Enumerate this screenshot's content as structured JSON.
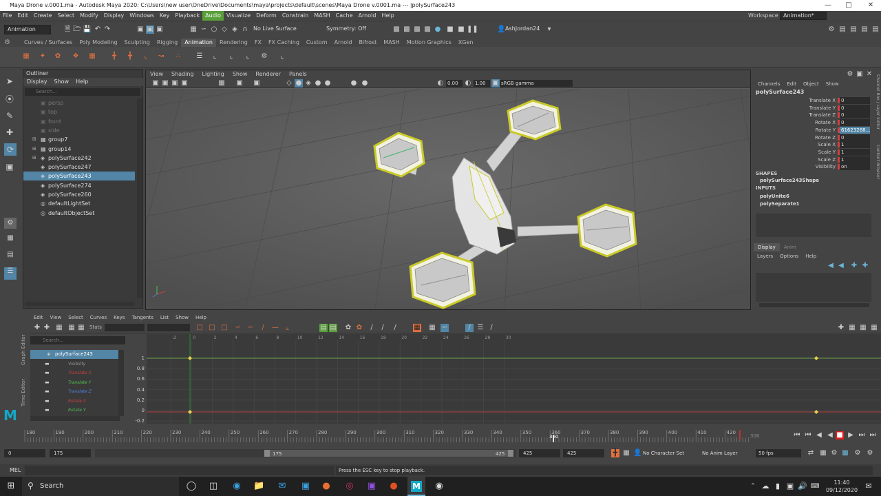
{
  "title": "Maya Drone v.0001.ma - Autodesk Maya 2020: C:\\Users\\new user\\OneDrive\\Documents\\maya\\projects\\default\\scenes\\Maya Drone v.0001.ma   ---   |polySurface243",
  "menu": [
    "File",
    "Edit",
    "Create",
    "Select",
    "Modify",
    "Display",
    "Windows",
    "Key",
    "Playback",
    "Audio",
    "Visualize",
    "Deform",
    "Constrain",
    "MASH",
    "Cache",
    "Arnold",
    "Help"
  ],
  "workspace_label": "Workspace :",
  "workspace_value": "Animation*",
  "mode_menu": "Animation",
  "live_surface": "No Live Surface",
  "symmetry": "Symmetry: Off",
  "user": "AshJordan24",
  "shelf_tabs": [
    "Curves / Surfaces",
    "Poly Modeling",
    "Sculpting",
    "Rigging",
    "Animation",
    "Rendering",
    "FX",
    "FX Caching",
    "Custom",
    "Arnold",
    "Bifrost",
    "MASH",
    "Motion Graphics",
    "XGen"
  ],
  "shelf_active": "Animation",
  "outliner": {
    "title": "Outliner",
    "menu": [
      "Display",
      "Show",
      "Help"
    ],
    "search_placeholder": "Search...",
    "items": [
      {
        "label": "persp",
        "dim": true
      },
      {
        "label": "top",
        "dim": true
      },
      {
        "label": "front",
        "dim": true
      },
      {
        "label": "side",
        "dim": true
      },
      {
        "label": "group7",
        "dim": false
      },
      {
        "label": "group14",
        "dim": false
      },
      {
        "label": "polySurface242",
        "dim": false
      },
      {
        "label": "polySurface247",
        "dim": false
      },
      {
        "label": "polySurface243",
        "dim": false,
        "selected": true
      },
      {
        "label": "polySurface274",
        "dim": false
      },
      {
        "label": "polySurface260",
        "dim": false
      },
      {
        "label": "defaultLightSet",
        "dim": false
      },
      {
        "label": "defaultObjectSet",
        "dim": false
      }
    ]
  },
  "viewport": {
    "menu": [
      "View",
      "Shading",
      "Lighting",
      "Show",
      "Renderer",
      "Panels"
    ],
    "exposure": "0.00",
    "gamma": "1.00",
    "colorspace": "sRGB gamma"
  },
  "channelbox": {
    "menu": [
      "Channels",
      "Edit",
      "Object",
      "Show"
    ],
    "object": "polySurface243",
    "channels": [
      {
        "label": "Translate X",
        "value": "0"
      },
      {
        "label": "Translate Y",
        "value": "0"
      },
      {
        "label": "Translate Z",
        "value": "0"
      },
      {
        "label": "Rotate X",
        "value": "0"
      },
      {
        "label": "Rotate Y",
        "value": "61623268..."
      },
      {
        "label": "Rotate Z",
        "value": "0"
      },
      {
        "label": "Scale X",
        "value": "1"
      },
      {
        "label": "Scale Y",
        "value": "1"
      },
      {
        "label": "Scale Z",
        "value": "1"
      },
      {
        "label": "Visibility",
        "value": "on"
      }
    ],
    "shapes_header": "SHAPES",
    "shape": "polySurface243Shape",
    "inputs_header": "INPUTS",
    "inputs": [
      "polyUnite6",
      "polySeparate1"
    ],
    "layer_tabs": [
      "Display",
      "Anim"
    ],
    "layer_menu": [
      "Layers",
      "Options",
      "Help"
    ],
    "side_tabs": [
      "Channel Box / Layer Editor",
      "Content Browser"
    ]
  },
  "graph_editor": {
    "side_label": "Graph Editor",
    "menu": [
      "Edit",
      "View",
      "Select",
      "Curves",
      "Keys",
      "Tangents",
      "List",
      "Show",
      "Help"
    ],
    "stats": "Stats",
    "search_placeholder": "Search...",
    "tree": [
      {
        "label": "polySurface243",
        "color": "#ffffff",
        "selected": true
      },
      {
        "label": "Visibility",
        "color": "#999999"
      },
      {
        "label": "Translate X",
        "color": "#d04040"
      },
      {
        "label": "Translate Y",
        "color": "#50c050"
      },
      {
        "label": "Translate Z",
        "color": "#5080e0"
      },
      {
        "label": "Rotate X",
        "color": "#d04040"
      },
      {
        "label": "Rotate Y",
        "color": "#50c050"
      }
    ],
    "y_ticks": [
      "1",
      "0.8",
      "0.6",
      "0.4",
      "0.2",
      "0",
      "-0.2"
    ],
    "x_ticks": [
      "-2",
      "0",
      "2",
      "4",
      "6",
      "8",
      "10",
      "12",
      "14",
      "16",
      "18",
      "20",
      "22",
      "24",
      "26",
      "28",
      "30"
    ]
  },
  "time_side_label": "Time Editor",
  "timeslider": {
    "ticks": [
      "180",
      "190",
      "200",
      "210",
      "220",
      "230",
      "240",
      "250",
      "260",
      "270",
      "280",
      "290",
      "300",
      "310",
      "320",
      "330",
      "340",
      "350",
      "360",
      "370",
      "380",
      "390",
      "400",
      "410",
      "420"
    ],
    "current_frame": "360",
    "current_display": "306"
  },
  "range": {
    "start": "0",
    "play_start": "175",
    "slider_start": "175",
    "slider_end": "425",
    "play_end": "425",
    "end": "425",
    "character_set": "No Character Set",
    "anim_layer": "No Anim Layer",
    "fps": "50 fps"
  },
  "cmdline": {
    "label": "MEL",
    "help": "Press the ESC key to stop playback."
  },
  "taskbar": {
    "search": "Search",
    "time": "11:40",
    "date": "09/12/2020"
  },
  "colors": {
    "accent_selected": "#5285a6",
    "audio": "#5a9f3a",
    "x_axis": "#d04040",
    "y_axis": "#50c050",
    "z_axis": "#5080e0"
  }
}
